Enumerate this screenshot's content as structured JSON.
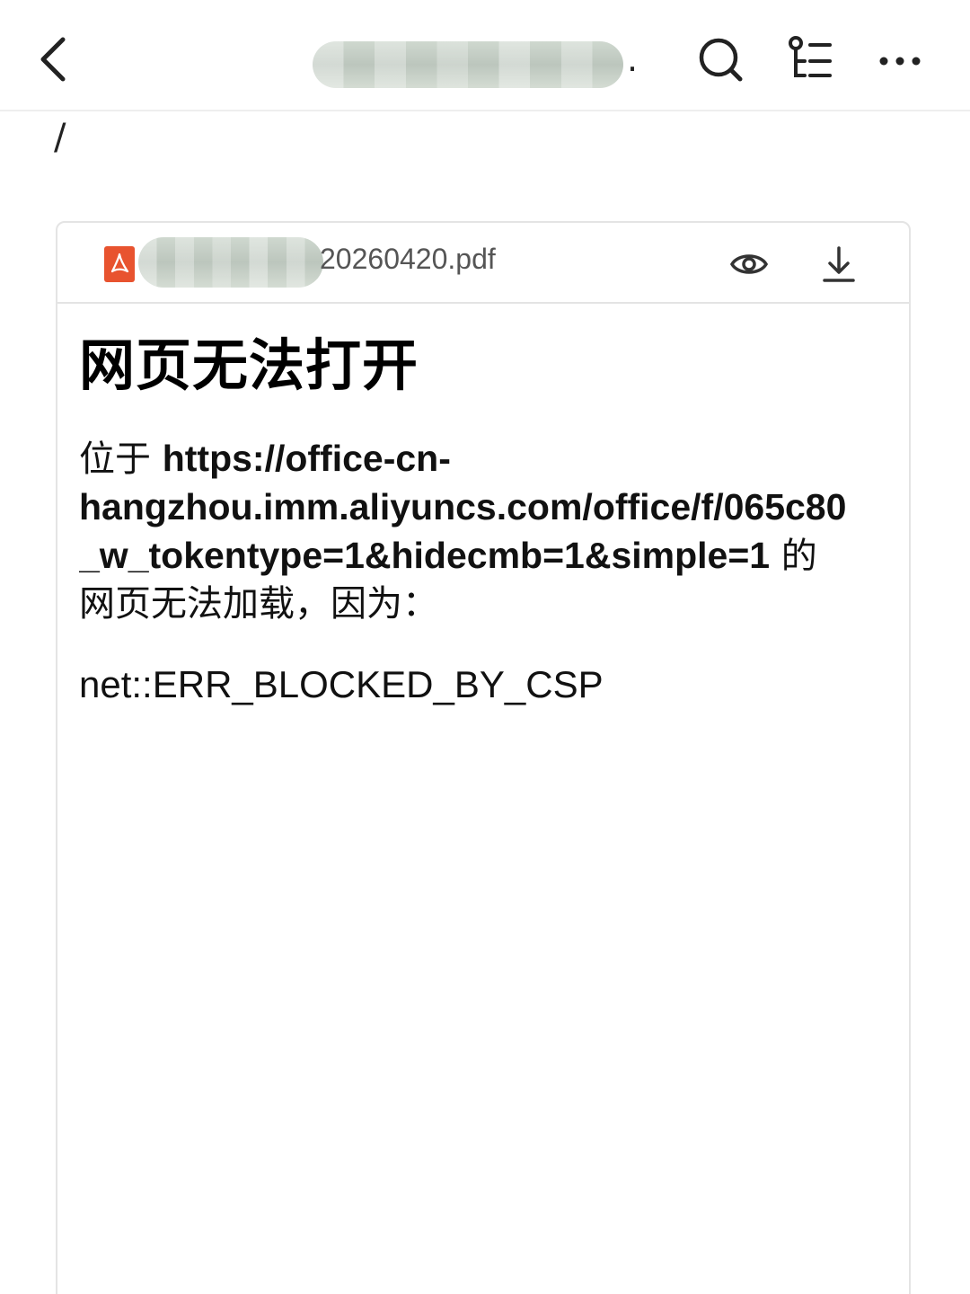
{
  "topbar": {
    "title_visible_suffix": ".",
    "icons": [
      "back-icon",
      "search-icon",
      "toc-icon",
      "more-icon"
    ]
  },
  "path": "/",
  "attachment": {
    "filename_suffix": "20260420.pdf",
    "file_icon": "pdf-icon",
    "actions": [
      "preview-eye-icon",
      "download-icon"
    ]
  },
  "preview": {
    "heading": "网页无法打开",
    "location_prefix": "位于",
    "url_line1": "https://office-cn-",
    "url_line2": "hangzhou.imm.aliyuncs.com/office/f/065c80",
    "url_line3": "_w_tokentype=1&hidecmb=1&simple=1",
    "location_suffix": "的",
    "reason_line": "网页无法加载，因为：",
    "error_code": "net::ERR_BLOCKED_BY_CSP"
  },
  "colors": {
    "pdf_icon": "#e8532f",
    "border": "#e4e4e4",
    "text": "#111111"
  }
}
